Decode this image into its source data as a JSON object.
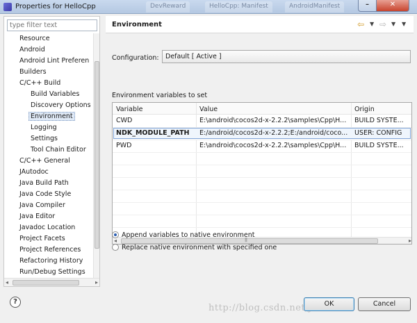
{
  "window": {
    "title": "Properties for HelloCpp",
    "background_tabs": [
      "DevReward",
      "HelloCpp: Manifest",
      "AndroidManifest"
    ],
    "minimize_label": "–",
    "close_label": "✕"
  },
  "filter": {
    "placeholder": "type filter text"
  },
  "tree": [
    {
      "label": "Resource",
      "level": 0
    },
    {
      "label": "Android",
      "level": 0
    },
    {
      "label": "Android Lint Preferen",
      "level": 0
    },
    {
      "label": "Builders",
      "level": 0
    },
    {
      "label": "C/C++ Build",
      "level": 0
    },
    {
      "label": "Build Variables",
      "level": 1
    },
    {
      "label": "Discovery Options",
      "level": 1
    },
    {
      "label": "Environment",
      "level": 1,
      "selected": true
    },
    {
      "label": "Logging",
      "level": 1
    },
    {
      "label": "Settings",
      "level": 1
    },
    {
      "label": "Tool Chain Editor",
      "level": 1
    },
    {
      "label": "C/C++ General",
      "level": 0
    },
    {
      "label": "JAutodoc",
      "level": 0
    },
    {
      "label": "Java Build Path",
      "level": 0
    },
    {
      "label": "Java Code Style",
      "level": 0
    },
    {
      "label": "Java Compiler",
      "level": 0
    },
    {
      "label": "Java Editor",
      "level": 0
    },
    {
      "label": "Javadoc Location",
      "level": 0
    },
    {
      "label": "Project Facets",
      "level": 0
    },
    {
      "label": "Project References",
      "level": 0
    },
    {
      "label": "Refactoring History",
      "level": 0
    },
    {
      "label": "Run/Debug Settings",
      "level": 0
    }
  ],
  "page": {
    "heading": "Environment",
    "nav": {
      "back_icon": "back-arrow-icon",
      "forward_icon": "forward-arrow-icon",
      "menu_icon": "view-menu-icon"
    },
    "configuration": {
      "label": "Configuration:",
      "value": "Default  [ Active ]"
    },
    "env_vars": {
      "label": "Environment variables to set",
      "columns": [
        "Variable",
        "Value",
        "Origin"
      ],
      "rows": [
        [
          "CWD",
          "E:\\android\\cocos2d-x-2.2.2\\samples\\Cpp\\H...",
          "BUILD SYSTE..."
        ],
        [
          "NDK_MODULE_PATH",
          "E:/android/cocos2d-x-2.2.2;E:/android/coco...",
          "USER: CONFIG"
        ],
        [
          "PWD",
          "E:\\android\\cocos2d-x-2.2.2\\samples\\Cpp\\H...",
          "BUILD SYSTE..."
        ]
      ],
      "selected_row": 1
    },
    "options": [
      {
        "label": "Append variables to native environment",
        "checked": true
      },
      {
        "label": "Replace native environment with specified one",
        "checked": false
      }
    ]
  },
  "footer": {
    "help_label": "?",
    "ok_label": "OK",
    "cancel_label": "Cancel",
    "watermark": "http://blog.csdn.net/jaswadse"
  },
  "colors": {
    "title_bar": "#c9d9ee",
    "selection_border": "#7fa3d6",
    "close_button": "#c8432d"
  }
}
